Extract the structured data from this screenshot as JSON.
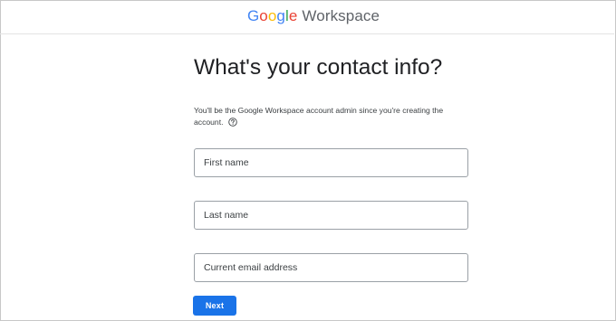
{
  "brand": {
    "letters": [
      {
        "char": "G",
        "color": "#4285F4"
      },
      {
        "char": "o",
        "color": "#EA4335"
      },
      {
        "char": "o",
        "color": "#FBBC05"
      },
      {
        "char": "g",
        "color": "#4285F4"
      },
      {
        "char": "l",
        "color": "#34A853"
      },
      {
        "char": "e",
        "color": "#EA4335"
      }
    ],
    "product": "Workspace"
  },
  "page": {
    "title": "What's your contact info?",
    "info_text": "You'll be the Google Workspace account admin since you're creating the account.",
    "help_icon": "help-circle-icon"
  },
  "form": {
    "first_name_placeholder": "First name",
    "last_name_placeholder": "Last name",
    "email_placeholder": "Current email address",
    "next_label": "Next"
  },
  "colors": {
    "accent": "#1a73e8",
    "field_border": "#9aa0a6"
  }
}
